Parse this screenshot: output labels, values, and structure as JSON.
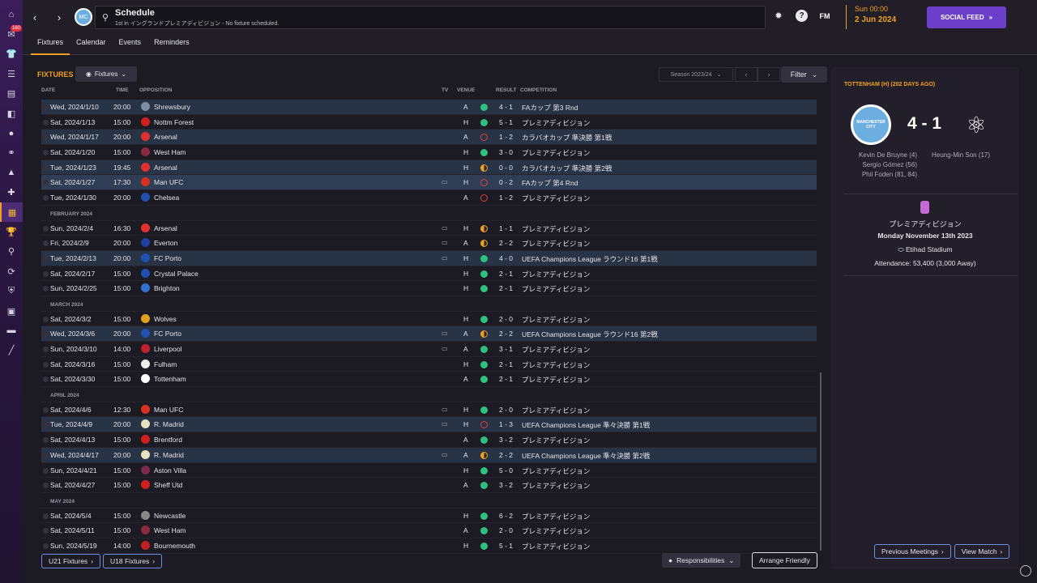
{
  "nav": {
    "badge": "160",
    "icons": [
      "home-icon",
      "inbox-icon",
      "squad-icon",
      "clipboard-icon",
      "tactics-icon",
      "data-icon",
      "circle-icon",
      "staff-icon",
      "training-icon",
      "medical-icon",
      "schedule-icon",
      "trophy-icon",
      "scouting-icon",
      "transfers-icon",
      "club-vision-icon",
      "finances-icon",
      "dev-centre-icon",
      "misc-icon"
    ]
  },
  "topbar": {
    "title": "Schedule",
    "subtitle": "1st in イングランドプレミアディビジョン - No fixture scheduled.",
    "fm_label": "FM",
    "date_line1": "Sun 00:00",
    "date_line2": "2 Jun 2024",
    "social_label": "SOCIAL FEED",
    "accent_color": "#f0a020",
    "social_color": "#6b3fc8"
  },
  "tabs": [
    "Fixtures",
    "Calendar",
    "Events",
    "Reminders"
  ],
  "fixtures": {
    "title": "FIXTURES",
    "dropdown_label": "Fixtures",
    "season_label": "Season 2023/24",
    "filter_label": "Filter",
    "headers": {
      "date": "DATE",
      "time": "TIME",
      "opposition": "OPPOSITION",
      "tv": "TV",
      "venue": "VENUE",
      "result": "RESULT",
      "competition": "COMPETITION"
    },
    "rows": [
      {
        "kind": "fixture",
        "date": "Wed, 2024/1/10",
        "time": "20:00",
        "opp": "Shrewsbury",
        "crest": "#7a8ea0",
        "tv": false,
        "venue": "A",
        "result": "w",
        "score": "4 - 1",
        "comp": "FAカップ 第3 Rnd",
        "hl": 1
      },
      {
        "kind": "fixture",
        "date": "Sat, 2024/1/13",
        "time": "15:00",
        "opp": "Nottm Forest",
        "crest": "#d02020",
        "tv": false,
        "venue": "H",
        "result": "w",
        "score": "5 - 1",
        "comp": "プレミアディビジョン",
        "hl": 0
      },
      {
        "kind": "fixture",
        "date": "Wed, 2024/1/17",
        "time": "20:00",
        "opp": "Arsenal",
        "crest": "#e03030",
        "tv": false,
        "venue": "A",
        "result": "l",
        "score": "1 - 2",
        "comp": "カラバオカップ 準決勝 第1戦",
        "hl": 1
      },
      {
        "kind": "fixture",
        "date": "Sat, 2024/1/20",
        "time": "15:00",
        "opp": "West Ham",
        "crest": "#8a2a40",
        "tv": false,
        "venue": "H",
        "result": "w",
        "score": "3 - 0",
        "comp": "プレミアディビジョン",
        "hl": 0
      },
      {
        "kind": "fixture",
        "date": "Tue, 2024/1/23",
        "time": "19:45",
        "opp": "Arsenal",
        "crest": "#e03030",
        "tv": false,
        "venue": "H",
        "result": "dd",
        "score": "0 - 0",
        "comp": "カラバオカップ 準決勝 第2戦",
        "hl": 1
      },
      {
        "kind": "fixture",
        "date": "Sat, 2024/1/27",
        "time": "17:30",
        "opp": "Man UFC",
        "crest": "#d83020",
        "tv": true,
        "venue": "H",
        "result": "l",
        "score": "0 - 2",
        "comp": "FAカップ 第4 Rnd",
        "hl": 2
      },
      {
        "kind": "fixture",
        "date": "Tue, 2024/1/30",
        "time": "20:00",
        "opp": "Chelsea",
        "crest": "#2050b0",
        "tv": false,
        "venue": "A",
        "result": "l",
        "score": "1 - 2",
        "comp": "プレミアディビジョン",
        "hl": 0
      },
      {
        "kind": "month",
        "label": "FEBRUARY 2024"
      },
      {
        "kind": "fixture",
        "date": "Sun, 2024/2/4",
        "time": "16:30",
        "opp": "Arsenal",
        "crest": "#e03030",
        "tv": true,
        "venue": "H",
        "result": "dd",
        "score": "1 - 1",
        "comp": "プレミアディビジョン",
        "hl": 0
      },
      {
        "kind": "fixture",
        "date": "Fri, 2024/2/9",
        "time": "20:00",
        "opp": "Everton",
        "crest": "#2040a0",
        "tv": true,
        "venue": "A",
        "result": "dd",
        "score": "2 - 2",
        "comp": "プレミアディビジョン",
        "hl": 0
      },
      {
        "kind": "fixture",
        "date": "Tue, 2024/2/13",
        "time": "20:00",
        "opp": "FC Porto",
        "crest": "#2050b0",
        "tv": true,
        "venue": "H",
        "result": "w",
        "score": "4 - 0",
        "comp": "UEFA Champions League ラウンド16 第1戦",
        "hl": 1
      },
      {
        "kind": "fixture",
        "date": "Sat, 2024/2/17",
        "time": "15:00",
        "opp": "Crystal Palace",
        "crest": "#2050b0",
        "tv": false,
        "venue": "H",
        "result": "w",
        "score": "2 - 1",
        "comp": "プレミアディビジョン",
        "hl": 0
      },
      {
        "kind": "fixture",
        "date": "Sun, 2024/2/25",
        "time": "15:00",
        "opp": "Brighton",
        "crest": "#3070d0",
        "tv": false,
        "venue": "H",
        "result": "w",
        "score": "2 - 1",
        "comp": "プレミアディビジョン",
        "hl": 0
      },
      {
        "kind": "month",
        "label": "MARCH 2024"
      },
      {
        "kind": "fixture",
        "date": "Sat, 2024/3/2",
        "time": "15:00",
        "opp": "Wolves",
        "crest": "#e0a020",
        "tv": false,
        "venue": "H",
        "result": "w",
        "score": "2 - 0",
        "comp": "プレミアディビジョン",
        "hl": 0
      },
      {
        "kind": "fixture",
        "date": "Wed, 2024/3/6",
        "time": "20:00",
        "opp": "FC Porto",
        "crest": "#2050b0",
        "tv": true,
        "venue": "A",
        "result": "dd",
        "score": "2 - 2",
        "comp": "UEFA Champions League ラウンド16 第2戦",
        "hl": 1
      },
      {
        "kind": "fixture",
        "date": "Sun, 2024/3/10",
        "time": "14:00",
        "opp": "Liverpool",
        "crest": "#c02030",
        "tv": true,
        "venue": "A",
        "result": "w",
        "score": "3 - 1",
        "comp": "プレミアディビジョン",
        "hl": 0
      },
      {
        "kind": "fixture",
        "date": "Sat, 2024/3/16",
        "time": "15:00",
        "opp": "Fulham",
        "crest": "#eeeeee",
        "tv": false,
        "venue": "H",
        "result": "w",
        "score": "2 - 1",
        "comp": "プレミアディビジョン",
        "hl": 0
      },
      {
        "kind": "fixture",
        "date": "Sat, 2024/3/30",
        "time": "15:00",
        "opp": "Tottenham",
        "crest": "#ffffff",
        "tv": false,
        "venue": "A",
        "result": "w",
        "score": "2 - 1",
        "comp": "プレミアディビジョン",
        "hl": 0
      },
      {
        "kind": "month",
        "label": "APRIL 2024"
      },
      {
        "kind": "fixture",
        "date": "Sat, 2024/4/6",
        "time": "12:30",
        "opp": "Man UFC",
        "crest": "#d83020",
        "tv": true,
        "venue": "H",
        "result": "w",
        "score": "2 - 0",
        "comp": "プレミアディビジョン",
        "hl": 0
      },
      {
        "kind": "fixture",
        "date": "Tue, 2024/4/9",
        "time": "20:00",
        "opp": "R. Madrid",
        "crest": "#e8e0c0",
        "tv": true,
        "venue": "H",
        "result": "l",
        "score": "1 - 3",
        "comp": "UEFA Champions League 準々決勝 第1戦",
        "hl": 1
      },
      {
        "kind": "fixture",
        "date": "Sat, 2024/4/13",
        "time": "15:00",
        "opp": "Brentford",
        "crest": "#d02020",
        "tv": false,
        "venue": "A",
        "result": "w",
        "score": "3 - 2",
        "comp": "プレミアディビジョン",
        "hl": 0
      },
      {
        "kind": "fixture",
        "date": "Wed, 2024/4/17",
        "time": "20:00",
        "opp": "R. Madrid",
        "crest": "#e8e0c0",
        "tv": true,
        "venue": "A",
        "result": "dd",
        "score": "2 - 2",
        "comp": "UEFA Champions League 準々決勝 第2戦",
        "hl": 1
      },
      {
        "kind": "fixture",
        "date": "Sun, 2024/4/21",
        "time": "15:00",
        "opp": "Aston Villa",
        "crest": "#7a2a50",
        "tv": false,
        "venue": "H",
        "result": "w",
        "score": "5 - 0",
        "comp": "プレミアディビジョン",
        "hl": 0
      },
      {
        "kind": "fixture",
        "date": "Sat, 2024/4/27",
        "time": "15:00",
        "opp": "Sheff Utd",
        "crest": "#d02020",
        "tv": false,
        "venue": "A",
        "result": "w",
        "score": "3 - 2",
        "comp": "プレミアディビジョン",
        "hl": 0
      },
      {
        "kind": "month",
        "label": "MAY 2024"
      },
      {
        "kind": "fixture",
        "date": "Sat, 2024/5/4",
        "time": "15:00",
        "opp": "Newcastle",
        "crest": "#888888",
        "tv": false,
        "venue": "H",
        "result": "w",
        "score": "6 - 2",
        "comp": "プレミアディビジョン",
        "hl": 0
      },
      {
        "kind": "fixture",
        "date": "Sat, 2024/5/11",
        "time": "15:00",
        "opp": "West Ham",
        "crest": "#8a2a40",
        "tv": false,
        "venue": "A",
        "result": "w",
        "score": "2 - 0",
        "comp": "プレミアディビジョン",
        "hl": 0
      },
      {
        "kind": "fixture",
        "date": "Sun, 2024/5/19",
        "time": "14:00",
        "opp": "Bournemouth",
        "crest": "#c02020",
        "tv": false,
        "venue": "H",
        "result": "w",
        "score": "5 - 1",
        "comp": "プレミアディビジョン",
        "hl": 0
      }
    ],
    "u21_label": "U21 Fixtures",
    "u18_label": "U18 Fixtures",
    "responsibilities_label": "Responsibilities",
    "arrange_label": "Arrange Friendly"
  },
  "match": {
    "title": "TOTTENHAM (H) (202 DAYS AGO)",
    "score": "4 - 1",
    "home_badge_text": "MANCHESTER CITY",
    "home_scorers": [
      "Kevin De Bruyne (4)",
      "Sergio Gómez (56)",
      "Phil Foden (81, 84)"
    ],
    "away_scorers": [
      "Heung-Min Son (17)"
    ],
    "competition": "プレミアディビジョン",
    "date": "Monday November 13th 2023",
    "venue": "Etihad Stadium",
    "attendance": "Attendance: 53,400 (3,000 Away)",
    "prev_label": "Previous Meetings",
    "view_label": "View Match"
  }
}
